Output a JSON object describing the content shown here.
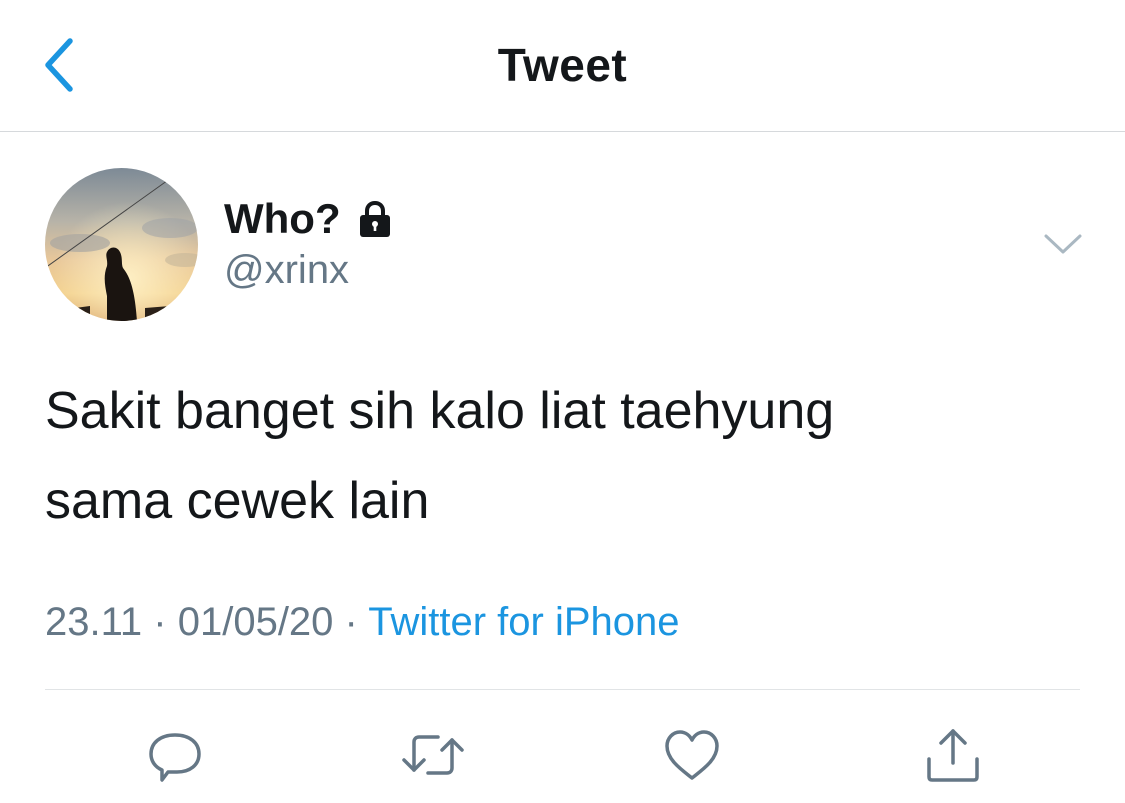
{
  "header": {
    "title": "Tweet",
    "back_icon": "chevron-left-icon",
    "accent_color": "#1b95e0"
  },
  "author": {
    "display_name": "Who?",
    "handle": "@xrinx",
    "protected_icon": "lock-icon",
    "avatar": "avatar"
  },
  "tweet": {
    "lines": [
      "Sakit banget sih kalo liat taehyung",
      "sama cewek lain"
    ]
  },
  "meta": {
    "time": "23.11",
    "separator": "·",
    "date": "01/05/20",
    "source": "Twitter for iPhone"
  },
  "actions": [
    {
      "name": "reply",
      "icon": "reply-icon"
    },
    {
      "name": "retweet",
      "icon": "retweet-icon"
    },
    {
      "name": "like",
      "icon": "heart-icon"
    },
    {
      "name": "share",
      "icon": "share-icon"
    }
  ]
}
